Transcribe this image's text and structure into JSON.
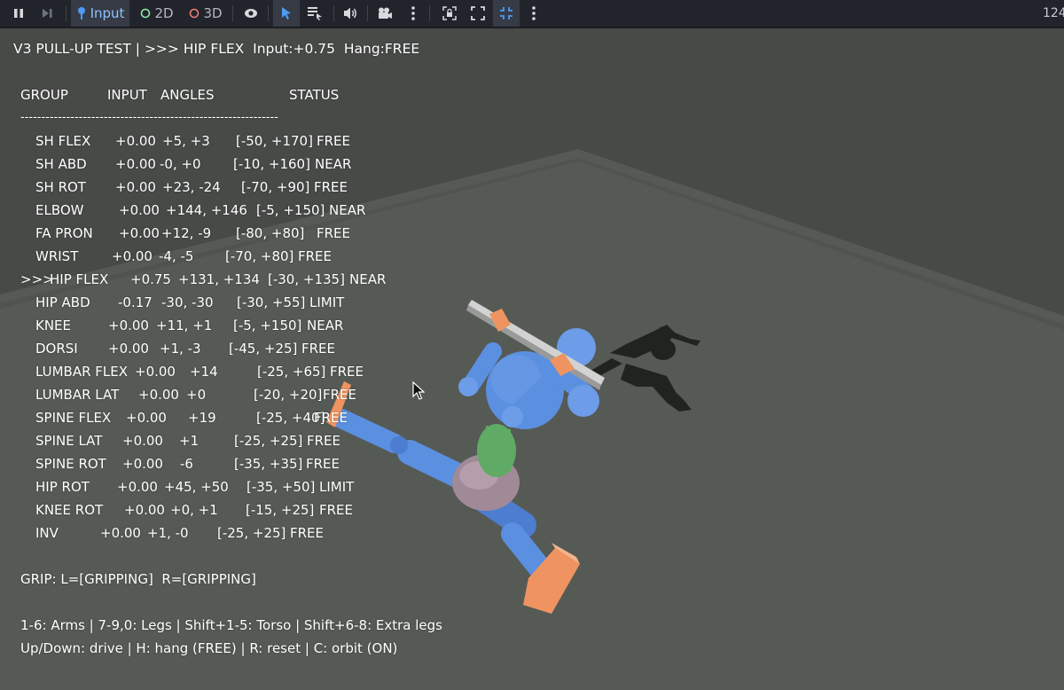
{
  "toolbar": {
    "input_label": "Input",
    "view_2d_label": "2D",
    "view_3d_label": "3D",
    "right_counter": "124",
    "icons": [
      "pause-icon",
      "step-icon",
      "input-icon",
      "eye-icon",
      "select-arrow-icon",
      "list-icon",
      "speaker-icon",
      "camera-icon",
      "more-icon",
      "lock-icon",
      "expand-icon",
      "fullscreen-icon",
      "more-icon"
    ]
  },
  "hud": {
    "title": "V3 PULL-UP TEST | >>> HIP FLEX  Input:+0.75  Hang:FREE",
    "headers": {
      "group": "GROUP",
      "input": "INPUT",
      "angles": "ANGLES",
      "status": "STATUS"
    },
    "divider": "--------------------------------------------------------------",
    "rows": [
      {
        "prefix": "",
        "group": "SH FLEX",
        "input": "+0.00",
        "angles": "+5, +3",
        "range": "[-50, +170]",
        "status": "FREE"
      },
      {
        "prefix": "",
        "group": "SH ABD",
        "input": "+0.00",
        "angles": "-0, +0",
        "range": "[-10, +160]",
        "status": "NEAR"
      },
      {
        "prefix": "",
        "group": "SH ROT",
        "input": "+0.00",
        "angles": "+23, -24",
        "range": "[-70, +90]",
        "status": "FREE"
      },
      {
        "prefix": "",
        "group": "ELBOW",
        "input": "+0.00",
        "angles": "+144, +146",
        "range": "[-5, +150]",
        "status": "NEAR"
      },
      {
        "prefix": "",
        "group": "FA PRON",
        "input": "+0.00",
        "angles": "+12, -9",
        "range": "[-80, +80]",
        "status": "FREE"
      },
      {
        "prefix": "",
        "group": "WRIST",
        "input": "+0.00",
        "angles": "-4, -5",
        "range": "[-70, +80]",
        "status": "FREE"
      },
      {
        "prefix": ">>>",
        "group": "HIP FLEX",
        "input": "+0.75",
        "angles": "+131, +134",
        "range": "[-30, +135]",
        "status": "NEAR"
      },
      {
        "prefix": "",
        "group": "HIP ABD",
        "input": "-0.17",
        "angles": "-30, -30",
        "range": "[-30, +55]",
        "status": "LIMIT"
      },
      {
        "prefix": "",
        "group": "KNEE",
        "input": "+0.00",
        "angles": "+11, +1",
        "range": "[-5, +150]",
        "status": "NEAR"
      },
      {
        "prefix": "",
        "group": "DORSI",
        "input": "+0.00",
        "angles": "+1, -3",
        "range": "[-45, +25]",
        "status": "FREE"
      },
      {
        "prefix": "",
        "group": "LUMBAR FLEX",
        "input": "+0.00",
        "angles": "+14",
        "range": "[-25, +65]",
        "status": "FREE"
      },
      {
        "prefix": "",
        "group": "LUMBAR LAT",
        "input": "+0.00",
        "angles": "+0",
        "range": "[-20, +20]",
        "status": "FREE"
      },
      {
        "prefix": "",
        "group": "SPINE FLEX",
        "input": "+0.00",
        "angles": "+19",
        "range": "[-25, +40]",
        "status": "FREE"
      },
      {
        "prefix": "",
        "group": "SPINE LAT",
        "input": "+0.00",
        "angles": "+1",
        "range": "[-25, +25]",
        "status": "FREE"
      },
      {
        "prefix": "",
        "group": "SPINE ROT",
        "input": "+0.00",
        "angles": "-6",
        "range": "[-35, +35]",
        "status": "FREE"
      },
      {
        "prefix": "",
        "group": "HIP ROT",
        "input": "+0.00",
        "angles": "+45, +50",
        "range": "[-35, +50]",
        "status": "LIMIT"
      },
      {
        "prefix": "",
        "group": "KNEE ROT",
        "input": "+0.00",
        "angles": "+0, +1",
        "range": "[-15, +25]",
        "status": "FREE"
      },
      {
        "prefix": "",
        "group": "INV",
        "input": "+0.00",
        "angles": "+1, -0",
        "range": "[-25, +25]",
        "status": "FREE"
      }
    ],
    "grip": "GRIP: L=[GRIPPING]  R=[GRIPPING]",
    "help_line_1": "1-6: Arms | 7-9,0: Legs | Shift+1-5: Torso | Shift+6-8: Extra legs",
    "help_line_2": "Up/Down: drive | H: hang (FREE) | R: reset | C: orbit (ON)"
  },
  "colors": {
    "toolbar_bg": "#21252b",
    "accent": "#4d9cf2",
    "viewport_bg": "#474a47",
    "ground": "#555a55",
    "body_blue": "#5b8fe0",
    "torso_green": "#5faa64",
    "pelvis_mauve": "#a08a98",
    "hand_orange": "#ef9460",
    "bar_gray": "#b8b8b8",
    "shadow": "#1c1e1c",
    "hud_text": "#ffffff"
  }
}
